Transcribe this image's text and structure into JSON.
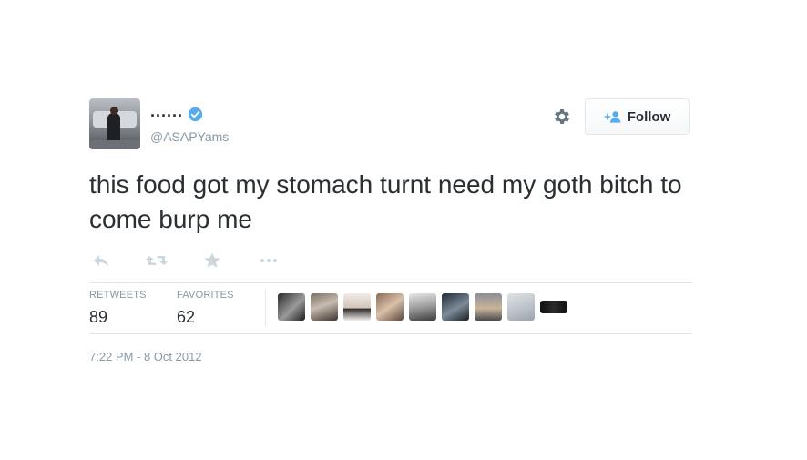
{
  "user": {
    "name": "......",
    "handle": "@ASAPYams",
    "verified": true
  },
  "follow_button": {
    "label": "Follow",
    "icon": "add-user-icon"
  },
  "tweet": {
    "text": "this food got my stomach turnt need my goth bitch to come burp me"
  },
  "actions": [
    "reply-icon",
    "retweet-icon",
    "star-icon",
    "more-icon"
  ],
  "stats": {
    "retweets": {
      "label": "RETWEETS",
      "value": "89"
    },
    "favorites": {
      "label": "FAVORITES",
      "value": "62"
    }
  },
  "timestamp": "7:22 PM - 8 Oct 2012",
  "colors": {
    "text": "#292f33",
    "muted": "#8899a6",
    "border": "#e1e8ed",
    "verified": "#55acee",
    "follow_icon": "#55acee"
  }
}
